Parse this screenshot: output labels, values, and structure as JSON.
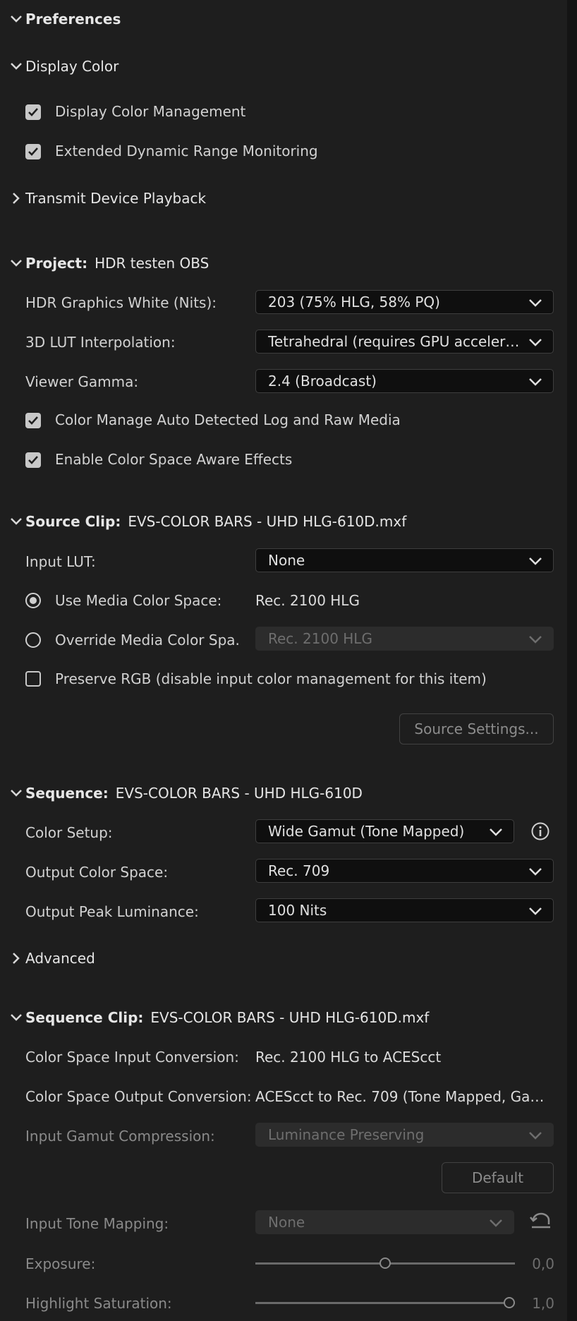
{
  "preferences": {
    "title": "Preferences"
  },
  "display_color": {
    "title": "Display Color",
    "display_color_management": {
      "label": "Display Color Management",
      "checked": true
    },
    "edr_monitoring": {
      "label": "Extended Dynamic Range Monitoring",
      "checked": true
    }
  },
  "transmit": {
    "title": "Transmit Device Playback"
  },
  "project": {
    "title": "Project:",
    "name": "HDR testen OBS",
    "hdr_white": {
      "label": "HDR Graphics White (Nits):",
      "value": "203 (75% HLG, 58% PQ)"
    },
    "lut_interp": {
      "label": "3D LUT Interpolation:",
      "value": "Tetrahedral (requires GPU accelera..."
    },
    "viewer_gamma": {
      "label": "Viewer Gamma:",
      "value": "2.4 (Broadcast)"
    },
    "auto_log": {
      "label": "Color Manage Auto Detected Log and Raw Media",
      "checked": true
    },
    "cs_aware": {
      "label": "Enable Color Space Aware Effects",
      "checked": true
    }
  },
  "source_clip": {
    "title": "Source Clip:",
    "name": "EVS-COLOR BARS - UHD HLG-610D.mxf",
    "input_lut": {
      "label": "Input LUT:",
      "value": "None"
    },
    "use_media": {
      "label": "Use Media Color Space:",
      "value": "Rec. 2100 HLG",
      "selected": true
    },
    "override_media": {
      "label": "Override Media Color Spa...",
      "value": "Rec. 2100 HLG",
      "selected": false
    },
    "preserve_rgb": {
      "label": "Preserve RGB (disable input color management for this item)",
      "checked": false
    },
    "source_settings_btn": "Source Settings..."
  },
  "sequence": {
    "title": "Sequence:",
    "name": "EVS-COLOR BARS - UHD HLG-610D",
    "color_setup": {
      "label": "Color Setup:",
      "value": "Wide Gamut (Tone Mapped)"
    },
    "output_cs": {
      "label": "Output Color Space:",
      "value": "Rec. 709"
    },
    "peak_lum": {
      "label": "Output Peak Luminance:",
      "value": "100 Nits"
    }
  },
  "advanced": {
    "title": "Advanced"
  },
  "sequence_clip": {
    "title": "Sequence Clip:",
    "name": "EVS-COLOR BARS - UHD HLG-610D.mxf",
    "cs_input": {
      "label": "Color Space Input Conversion:",
      "value": "Rec. 2100 HLG to ACEScct"
    },
    "cs_output": {
      "label": "Color Space Output Conversion:",
      "value": "ACEScct to Rec. 709 (Tone Mapped, Gam..."
    },
    "gamut_comp": {
      "label": "Input Gamut Compression:",
      "value": "Luminance Preserving"
    },
    "default_btn": "Default",
    "tone_mapping": {
      "label": "Input Tone Mapping:",
      "value": "None"
    },
    "exposure": {
      "label": "Exposure:",
      "value": "0,0",
      "position": 0.5
    },
    "highlight_sat": {
      "label": "Highlight Saturation:",
      "value": "1,0",
      "position": 1.0
    }
  },
  "colors": {
    "background": "#1e1e1e",
    "dropdown_bg": "#0f0f0f",
    "disabled_bg": "#2c2c2c",
    "text": "#dcdcdc",
    "dim_text": "#8a8a8a"
  },
  "icons": {
    "expand": "chevron-down-icon",
    "collapse": "chevron-right-icon",
    "dropdown": "chevron-down-icon",
    "info": "info-icon",
    "reset": "reset-icon",
    "check": "check-icon"
  }
}
